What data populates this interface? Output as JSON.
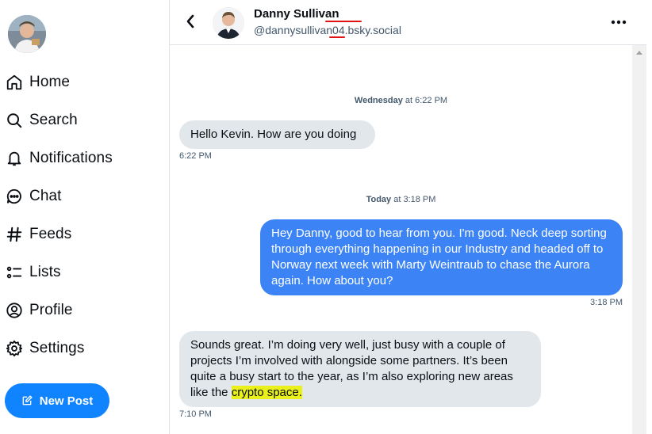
{
  "sidebar": {
    "nav": [
      {
        "label": "Home",
        "icon": "home-icon"
      },
      {
        "label": "Search",
        "icon": "search-icon"
      },
      {
        "label": "Notifications",
        "icon": "bell-icon"
      },
      {
        "label": "Chat",
        "icon": "chat-icon"
      },
      {
        "label": "Feeds",
        "icon": "hash-icon"
      },
      {
        "label": "Lists",
        "icon": "list-icon"
      },
      {
        "label": "Profile",
        "icon": "user-circle-icon"
      },
      {
        "label": "Settings",
        "icon": "gear-icon"
      }
    ],
    "new_post_label": "New Post"
  },
  "header": {
    "name": "Danny Sullivan",
    "handle": "@dannysullivan04.bsky.social"
  },
  "conversation": {
    "day1": {
      "day": "Wednesday",
      "time": " at 6:22 PM"
    },
    "msg1": {
      "text": "Hello Kevin. How are you doing",
      "time": "6:22 PM"
    },
    "day2": {
      "day": "Today",
      "time": " at 3:18 PM"
    },
    "msg2": {
      "text": "Hey Danny, good to hear from you. I'm good. Neck deep sorting through everything happening in our Industry and headed off to Norway next week with Marty Weintraub to chase the Aurora again. How about you?",
      "time": "3:18 PM"
    },
    "msg3": {
      "text_before": "Sounds great. I’m doing very well, just busy with a couple of projects I’m involved with alongside some partners. It’s been quite a busy start to the year, as I’m also exploring new areas like the ",
      "text_highlight": "crypto space.",
      "time": "7:10 PM"
    }
  },
  "colors": {
    "accent": "#1083fe",
    "outgoing_bubble": "#3c84f5",
    "incoming_bubble": "#e2e7ec",
    "highlight": "#e9f01c",
    "annotation_red": "#e01414"
  }
}
